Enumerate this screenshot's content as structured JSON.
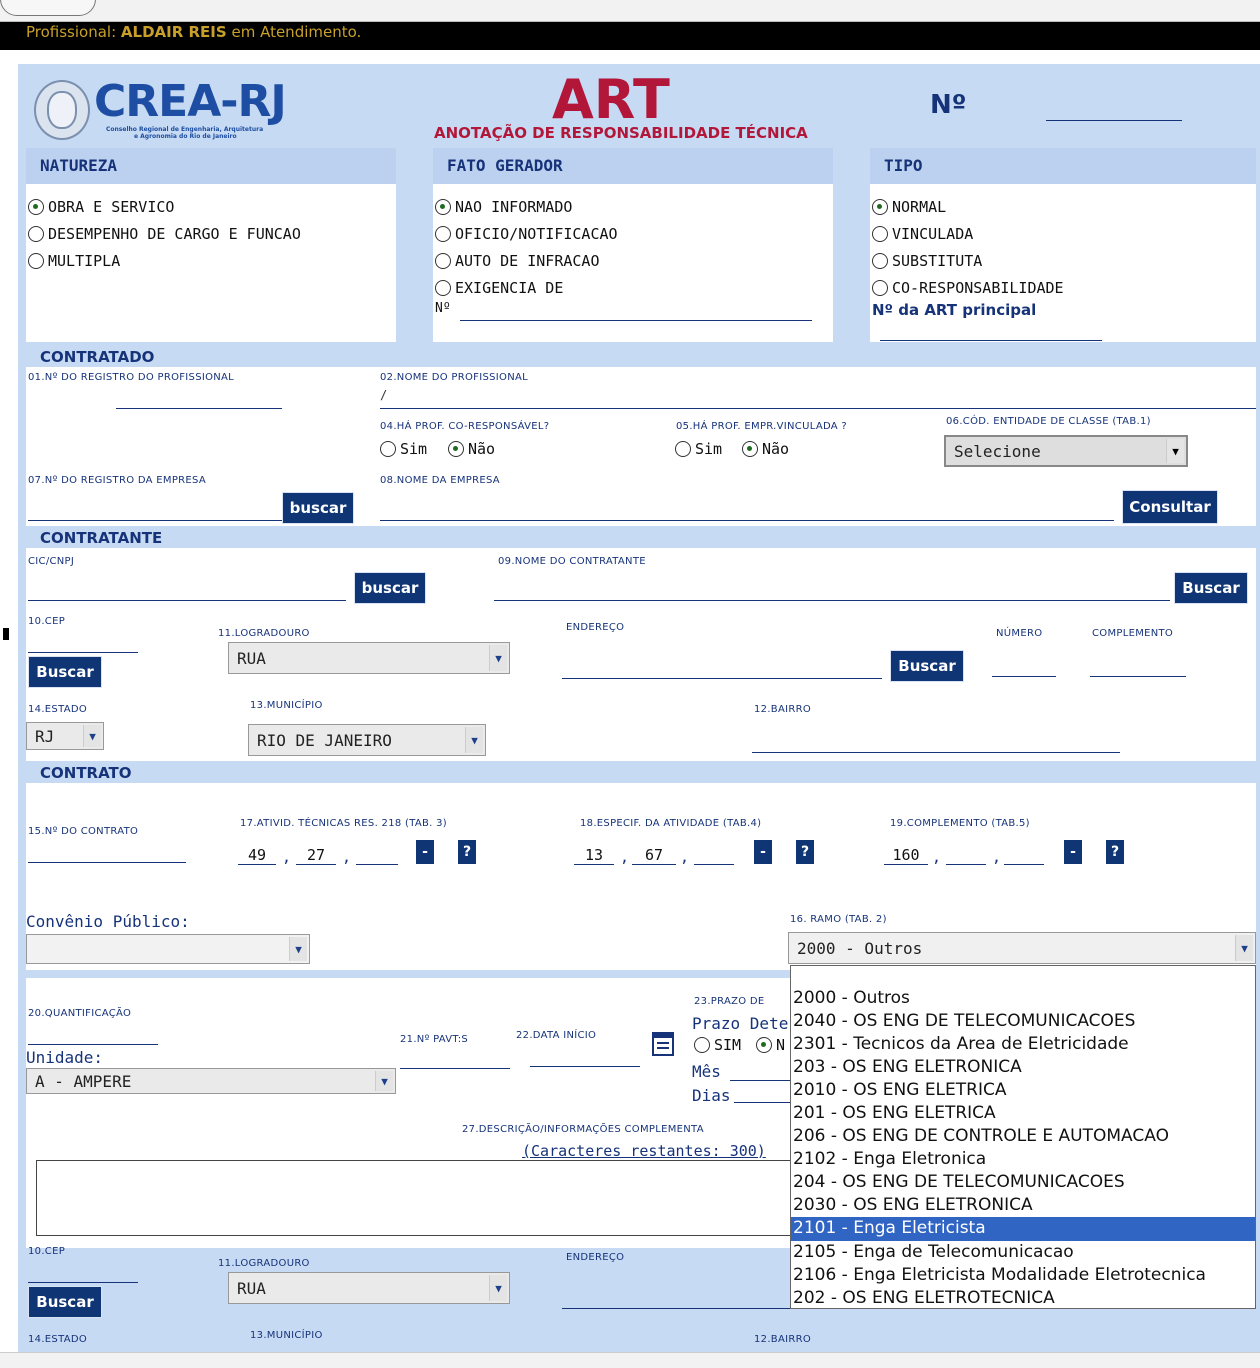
{
  "top_bar": {
    "message_prefix": "Profissional:",
    "user_name": "ALDAIR REIS",
    "message_suffix": "em Atendimento."
  },
  "header": {
    "logo_text": "CREA-RJ",
    "logo_sub1": "Conselho Regional de Engenharia, Arquitetura",
    "logo_sub2": "e Agronomia do Rio de Janeiro",
    "title": "ART",
    "subtitle": "ANOTAÇÃO DE RESPONSABILIDADE TÉCNICA",
    "number_label": "Nº"
  },
  "natureza": {
    "title": "NATUREZA",
    "options": [
      "OBRA E SERVICO",
      "DESEMPENHO DE CARGO E FUNCAO",
      "MULTIPLA"
    ]
  },
  "fato_gerador": {
    "title": "FATO GERADOR",
    "options": [
      "NAO INFORMADO",
      "OFICIO/NOTIFICACAO",
      "AUTO DE INFRACAO",
      "EXIGENCIA DE"
    ],
    "number_label": "Nº"
  },
  "tipo": {
    "title": "TIPO",
    "options": [
      "NORMAL",
      "VINCULADA",
      "SUBSTITUTA",
      "CO-RESPONSABILIDADE"
    ],
    "art_principal_label": "Nº da ART principal"
  },
  "contratado": {
    "title": "CONTRATADO",
    "f01": "01.nº do registro do profissional",
    "f02": "02.nome do profissional",
    "f02_value": "/",
    "f04": "04.há prof. co-responsável?",
    "f05": "05.há prof. empr.vinculada ?",
    "f06": "06.cód. entidade de classe (tab.1)",
    "sim": "Sim",
    "nao": "Não",
    "entidade_value": "Selecione",
    "f07": "07.nº do registro da empresa",
    "f08": "08.nome da empresa",
    "buscar": "buscar",
    "consultar": "Consultar"
  },
  "contratante": {
    "title": "CONTRATANTE",
    "cic": "cic/cnpj",
    "f09": "09.nome do contratante",
    "buscar": "buscar",
    "buscar2": "Buscar",
    "cep": "10.cep",
    "logradouro": "11.logradouro",
    "logradouro_value": "RUA",
    "endereco": "endereço",
    "numero": "número",
    "complemento": "complemento",
    "estado": "14.estado",
    "estado_value": "RJ",
    "municipio": "13.município",
    "municipio_value": "RIO DE JANEIRO",
    "bairro": "12.bairro"
  },
  "contrato": {
    "title": "CONTRATO",
    "f15": "15.nº do contrato",
    "f17": "17.ativid. técnicas res. 218 (tab. 3)",
    "f17_values": [
      "49",
      "27",
      ""
    ],
    "f18": "18.especif. da atividade (tab.4)",
    "f18_values": [
      "13",
      "67",
      ""
    ],
    "f19": "19.complemento (tab.5)",
    "f19_values": [
      "160",
      "",
      ""
    ],
    "minus": "-",
    "help": "?",
    "sep": ","
  },
  "convenio": {
    "label": "Convênio Público:",
    "ramo_label": "16. ramo (tab. 2)",
    "ramo_value": "2000 - Outros"
  },
  "details": {
    "f20": "20.quantificação",
    "unidade_label": "Unidade:",
    "unidade_value": "A - AMPERE",
    "f21": "21.nº pavt:s",
    "f22": "22.data início",
    "f23": "23.prazo de",
    "prazo_label": "Prazo Dete",
    "sim": "SIM",
    "n": "N",
    "mes": "Mês",
    "dias": "Dias",
    "f27": "27.descrição/informações complementa",
    "chars": "(Caracteres restantes: 300)"
  },
  "address2": {
    "cep": "10.cep",
    "logradouro": "11.logradouro",
    "logradouro_value": "RUA",
    "endereco": "endereço",
    "estado": "14.estado",
    "municipio": "13.município",
    "bairro": "12.bairro",
    "buscar": "Buscar"
  },
  "ramo_dropdown": {
    "items": [
      "2000 - Outros",
      "2040 - OS ENG DE TELECOMUNICACOES",
      "2301 - Tecnicos da Area de Eletricidade",
      "203 - OS ENG ELETRONICA",
      "2010 - OS ENG ELETRICA",
      "201 - OS ENG ELETRICA",
      "206 - OS ENG DE CONTROLE E AUTOMACAO",
      "2102 - Enga Eletronica",
      "204 - OS ENG DE TELECOMUNICACOES",
      "2030 - OS ENG ELETRONICA",
      "2101 - Enga Eletricista",
      "2105 - Enga de Telecomunicacao",
      "2106 - Enga Eletricista Modalidade Eletrotecnica",
      "202 - OS ENG ELETROTECNICA"
    ],
    "highlighted_index": 10
  },
  "colors": {
    "brand_blue": "#16337a",
    "button_blue": "#0f3575",
    "art_red": "#b2173a",
    "highlight": "#3165c4",
    "section_bg": "#c7daf3"
  }
}
